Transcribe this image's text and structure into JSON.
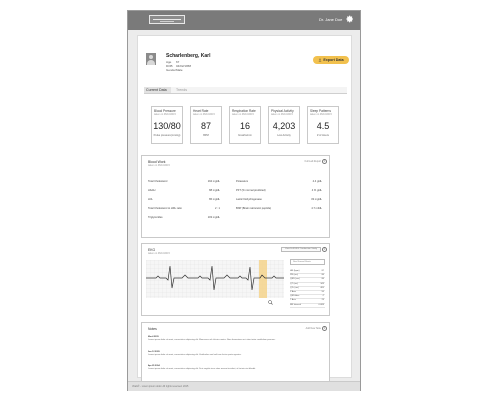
{
  "header": {
    "user_name": "Dr. Jane Doe",
    "icons": [
      "logo",
      "gear-icon"
    ]
  },
  "patient": {
    "name": "Scharlenberg, Karl",
    "fields": [
      {
        "label": "Age",
        "value": "67"
      },
      {
        "label": "DOB",
        "value": "04/02/1958"
      },
      {
        "label": "Gender",
        "value": "Male"
      }
    ]
  },
  "export_label": "Export Data",
  "tabs": [
    {
      "label": "Current Data",
      "active": true
    },
    {
      "label": "Trends",
      "active": false
    }
  ],
  "cards": [
    {
      "title": "Blood Pressure",
      "sub": "taken on 06/10/2015",
      "value": "130/80",
      "unit": "Pulse pressure(mmHg)"
    },
    {
      "title": "Heart Rate",
      "sub": "taken on 06/10/2015",
      "value": "87",
      "unit": "BPM"
    },
    {
      "title": "Respiration Rate",
      "sub": "taken on 06/10/2015",
      "value": "16",
      "unit": "breaths/min"
    },
    {
      "title": "Physical Activity",
      "sub": "taken on 06/10/2015",
      "value": "4,203",
      "unit": "Low Activity"
    },
    {
      "title": "Sleep Patterns",
      "sub": "taken on 06/10/2015",
      "value": "4.5",
      "unit": "# of Hours"
    }
  ],
  "blood": {
    "title": "Blood Work",
    "sub": "taken on 06/10/2015",
    "link": "Full Lab Report",
    "left": [
      {
        "label": "Total Cholesterol",
        "value": "194 mg/dL"
      },
      {
        "label": "HbA1c",
        "value": "88 mg/dL"
      },
      {
        "label": "LDL",
        "value": "86 mg/dL"
      },
      {
        "label": "Total Cholesterol to HDL ratio",
        "value": "2 : 1"
      },
      {
        "label": "Triglycerides",
        "value": "103 mg/dL"
      }
    ],
    "right": [
      {
        "label": "Potassium",
        "value": "4.4 g/dL"
      },
      {
        "label": "PFT (% normal predicted)",
        "value": "4 % g/dL"
      },
      {
        "label": "Lactic Dehydrogenase",
        "value": "33 mg/dL"
      },
      {
        "label": "BNP (Brain natriuretic peptide)",
        "value": "4.7 ml/dL"
      }
    ]
  },
  "ekg": {
    "title": "EKG",
    "sub": "taken on 06/10/2015",
    "button": "View Full EKG Conduction Study",
    "dropdown": "Non Normal Beats",
    "rows": [
      {
        "label": "HR (bpm)",
        "value": "87"
      },
      {
        "label": "PR (ms)",
        "value": "86"
      },
      {
        "label": "QRS (ms)",
        "value": "86"
      },
      {
        "label": "QT (ms)",
        "value": "343"
      },
      {
        "label": "QTc (ms)",
        "value": "405"
      },
      {
        "label": "P Axis",
        "value": "55"
      },
      {
        "label": "QRS Axis",
        "value": "-7"
      },
      {
        "label": "T Axis",
        "value": "23"
      },
      {
        "label": "RR Interval",
        "value": "0.689"
      }
    ]
  },
  "notes": {
    "title": "Notes",
    "link": "Add New Note",
    "items": [
      {
        "date": "Mar 4 2015",
        "text": "Lorem ipsum dolor sit amet, consectetur adipiscing elit. Maecenas vel ultricies metus. Nam fermentum orci vitae tortor vestibulum posuere."
      },
      {
        "date": "Jan 12 2015",
        "text": "Lorem ipsum dolor sit amet, consectetur adipiscing elit. Vestibulum sed velit non lectus porta egestas."
      },
      {
        "date": "Apr 25 2014",
        "text": "Lorem ipsum dolor sit amet, consectetur adipiscing elit. Duis sagittis risus vitae massa tincidunt, ut lacinia nisi blandit."
      }
    ]
  },
  "footer": "Vitals® - Lorem ipsum dolor. All rights reserved. 2015"
}
